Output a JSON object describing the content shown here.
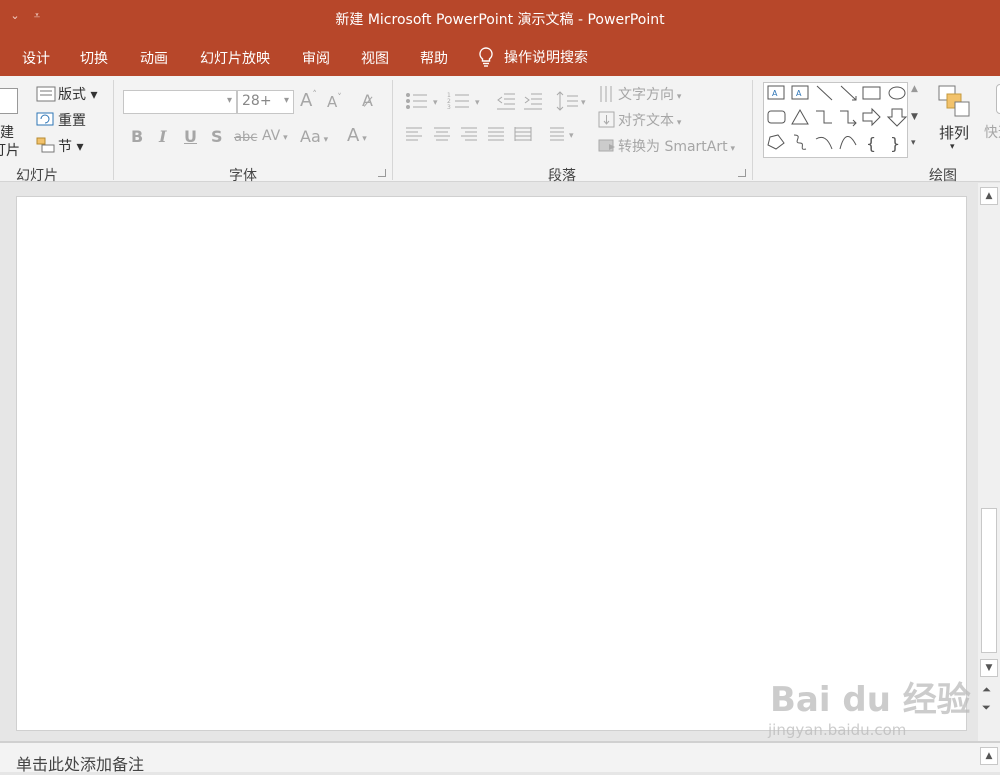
{
  "titlebar": {
    "title": "新建 Microsoft PowerPoint 演示文稿  -  PowerPoint",
    "qat_icons": [
      "undo-icon",
      "customize-qat-icon"
    ]
  },
  "menu": {
    "tabs": [
      "设计",
      "切换",
      "动画",
      "幻灯片放映",
      "审阅",
      "视图",
      "帮助"
    ],
    "tell_me": "操作说明搜索"
  },
  "ribbon": {
    "slides_group": {
      "new_slide_label": "建",
      "new_slide_label2": "灯片",
      "layout": "版式",
      "reset": "重置",
      "section": "节",
      "group_label": "幻灯片"
    },
    "font_group": {
      "font_name": "",
      "font_size": "28+",
      "group_label": "字体",
      "bold": "B",
      "italic": "I",
      "underline": "U",
      "shadow": "S",
      "strike": "abc",
      "spacing": "AV",
      "case": "Aa",
      "color": "A"
    },
    "paragraph_group": {
      "text_direction": "文字方向",
      "align_text": "对齐文本",
      "smartart": "转换为 SmartArt",
      "group_label": "段落"
    },
    "drawing_group": {
      "arrange": "排列",
      "quick_styles": "快速",
      "group_label": "绘图"
    }
  },
  "notes": {
    "placeholder": "单击此处添加备注"
  },
  "watermark": {
    "brand": "Bai du 经验",
    "url": "jingyan.baidu.com"
  },
  "colors": {
    "accent": "#b7472a",
    "ribbon_bg": "#f3f3f3",
    "workspace_bg": "#e6e6e6"
  }
}
